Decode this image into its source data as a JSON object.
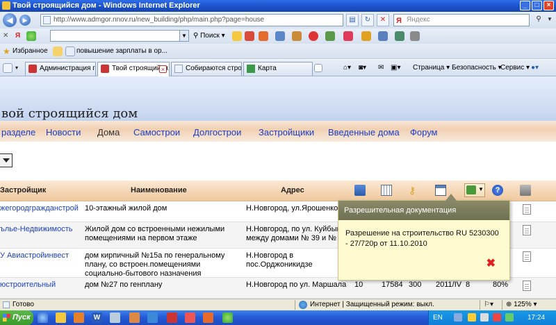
{
  "window": {
    "title": "Твой строящийся дом - Windows Internet Explorer"
  },
  "address": {
    "url": "http://www.admgor.nnov.ru/new_building/php/main.php?page=house",
    "search_placeholder": "Яндекс"
  },
  "toolbar": {
    "search_label": "Поиск",
    "ya_logo": "Я"
  },
  "favorites": {
    "label": "Избранное",
    "item": "повышение зарплаты в ор..."
  },
  "tabs": [
    {
      "label": "Администрация го..."
    },
    {
      "label": "Твой строящийся..."
    },
    {
      "label": "Собираются строи..."
    },
    {
      "label": "Карта"
    }
  ],
  "commands": {
    "page": "Страница",
    "safety": "Безопасность",
    "service": "Сервис"
  },
  "site": {
    "title": "вой строящийся дом",
    "nav": [
      "разделе",
      "Новости",
      "Дома",
      "Самострои",
      "Долгострои",
      "Застройщики",
      "Введенные дома",
      "Форум"
    ]
  },
  "table": {
    "headers": {
      "developer": "Застройщик",
      "name": "Наименование",
      "address": "Адрес"
    },
    "rows": [
      {
        "developer": "жегородгражданстрой",
        "name": "10-этажный жилой дом",
        "address": "Н.Новгород, ул.Ярошенко, д"
      },
      {
        "developer": "ълье-Недвижимость",
        "name": "Жилой дом со встроенными нежилыми помещениями на первом этаже",
        "address": "Н.Новгород, по ул. Куйбыше между домами № 39 и № 4"
      },
      {
        "developer": "У Авиастройинвест",
        "name": "дом кирпичный №15а по генеральному плану, со встроен.помещениями социально-бытового назначения",
        "address": "Н.Новгород в пос.Орджоникидзе"
      },
      {
        "developer": "юстроительный",
        "name": "дом №27 по генплану",
        "address": "Н.Новгород по ул. Маршала",
        "c1": "10",
        "c2": "17584",
        "c3": "300",
        "c4": "2011/IV",
        "c5": "8",
        "c6": "80%"
      }
    ]
  },
  "popup": {
    "title": "Разрешительная документация",
    "text": "Разрешение на строительство RU 5230300 - 27/720р от 11.10.2010"
  },
  "status": {
    "left": "Готово",
    "zone": "Интернет | Защищенный режим: выкл.",
    "zoom": "125%"
  },
  "taskbar": {
    "start": "Пуск",
    "lang": "EN",
    "time": "17:24"
  }
}
